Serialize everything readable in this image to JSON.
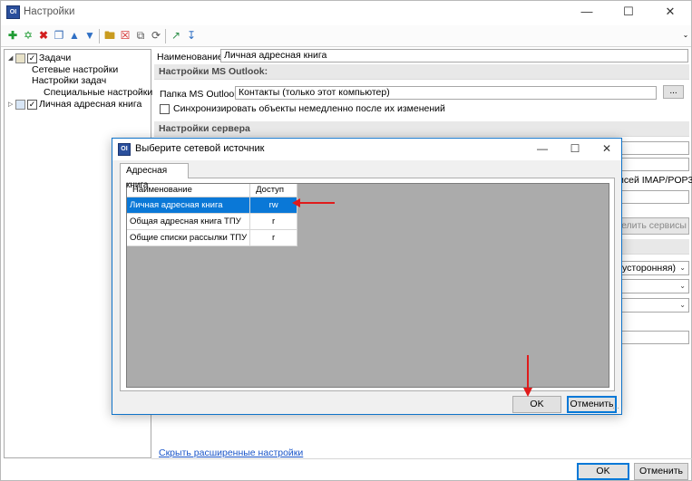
{
  "window": {
    "title": "Настройки",
    "icon_text": "OI",
    "buttons": [
      "minimize-icon",
      "maximize-icon",
      "close-icon"
    ]
  },
  "toolbar": {
    "icons": [
      "add-icon",
      "add-child-icon",
      "delete-icon",
      "copy-icon",
      "move-up-icon",
      "move-down-icon",
      "folder-icon",
      "remove-icon",
      "duplicate-icon",
      "refresh-icon",
      "export-icon",
      "import-icon"
    ]
  },
  "tree": {
    "items": [
      {
        "label": "Задачи",
        "checked": true,
        "expanded": true
      },
      {
        "label": "Сетевые настройки"
      },
      {
        "label": "Настройки задач"
      },
      {
        "label": "Специальные настройки"
      },
      {
        "label": "Личная адресная книга",
        "checked": true,
        "expanded": false
      }
    ]
  },
  "form": {
    "name_label": "Наименование:",
    "name_value": "Личная адресная книга",
    "outlook_section": "Настройки MS Outlook:",
    "folder_label": "Папка MS Outlook:",
    "folder_value": "Контакты (только этот компьютер)",
    "browse_label": "...",
    "sync_label": "Синхронизировать объекты немедленно после их изменений",
    "sync_checked": false,
    "server_section": "Настройки сервера",
    "imap_label": "исей IMAP/POP3",
    "services_btn": "елить сервисы",
    "dropdown1": "усторонняя)"
  },
  "footer": {
    "hide_link": "Скрыть расширенные настройки",
    "ok": "OK",
    "cancel": "Отменить"
  },
  "dialog": {
    "title": "Выберите сетевой источник",
    "icon_text": "OI",
    "tab": "Адресная книга",
    "columns": [
      "Наименование",
      "Доступ"
    ],
    "rows": [
      {
        "name": "Личная адресная книга",
        "access": "rw",
        "selected": true
      },
      {
        "name": "Общая адресная книга ТПУ",
        "access": "r"
      },
      {
        "name": "Общие списки рассылки ТПУ",
        "access": "r"
      }
    ],
    "ok": "OK",
    "cancel": "Отменить"
  },
  "colors": {
    "selection": "#0a78d7",
    "annotation_arrow": "#e01b1b",
    "link": "#1a55c9"
  }
}
